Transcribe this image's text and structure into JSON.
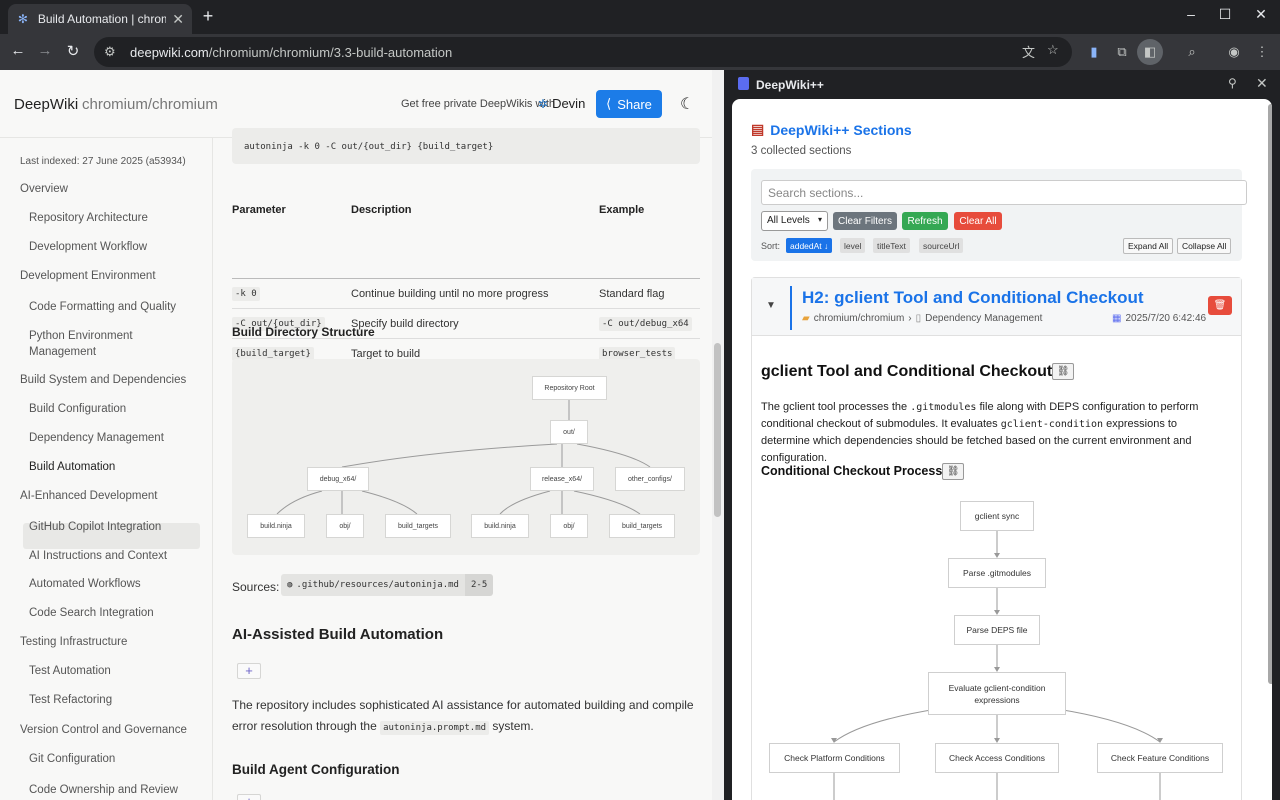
{
  "browser": {
    "tab_title": "Build Automation | chromium/c",
    "tab_close": "✕",
    "new_tab": "+",
    "url_host": "deepwiki.com",
    "url_path": "/chromium/chromium/3.3-build-automation"
  },
  "page": {
    "brand": "DeepWiki",
    "repo": "chromium/chromium",
    "promo": "Get free private DeepWikis with",
    "devin": "Devin",
    "share": "Share",
    "last_indexed": "Last indexed: 27 June 2025 (a53934)",
    "nav": [
      {
        "label": "Overview",
        "level": 1
      },
      {
        "label": "Repository Architecture",
        "level": 2
      },
      {
        "label": "Development Workflow",
        "level": 2
      },
      {
        "label": "Development Environment",
        "level": 1
      },
      {
        "label": "Code Formatting and Quality",
        "level": 2
      },
      {
        "label": "Python Environment Management",
        "level": 2
      },
      {
        "label": "Build System and Dependencies",
        "level": 1
      },
      {
        "label": "Build Configuration",
        "level": 2
      },
      {
        "label": "Dependency Management",
        "level": 2
      },
      {
        "label": "Build Automation",
        "level": 2,
        "active": true
      },
      {
        "label": "AI-Enhanced Development",
        "level": 1
      },
      {
        "label": "GitHub Copilot Integration",
        "level": 2
      },
      {
        "label": "AI Instructions and Context",
        "level": 2
      },
      {
        "label": "Automated Workflows",
        "level": 2
      },
      {
        "label": "Code Search Integration",
        "level": 2
      },
      {
        "label": "Testing Infrastructure",
        "level": 1
      },
      {
        "label": "Test Automation",
        "level": 2
      },
      {
        "label": "Test Refactoring",
        "level": 2
      },
      {
        "label": "Version Control and Governance",
        "level": 1
      },
      {
        "label": "Git Configuration",
        "level": 2
      },
      {
        "label": "Code Ownership and Review",
        "level": 2
      }
    ],
    "code_line": "autoninja -k 0 -C out/{out_dir} {build_target}",
    "table": {
      "headers": [
        "Parameter",
        "Description",
        "Example"
      ],
      "rows": [
        {
          "param": "-k 0",
          "desc": "Continue building until no more progress",
          "example": "Standard flag",
          "example_code": false
        },
        {
          "param": "-C out/{out_dir}",
          "desc": "Specify build directory",
          "example": "-C out/debug_x64",
          "example_code": true
        },
        {
          "param": "{build_target}",
          "desc": "Target to build",
          "example": "browser_tests",
          "example_code": true
        }
      ]
    },
    "dir_title": "Build Directory Structure",
    "dir_nodes": {
      "root": "Repository Root",
      "out": "out/",
      "debug": "debug_x64/",
      "release": "release_x64/",
      "other": "other_configs/",
      "d_ninja": "build.ninja",
      "d_obj": "obj/",
      "d_targets": "build_targets",
      "r_ninja": "build.ninja",
      "r_obj": "obj/",
      "r_targets": "build_targets"
    },
    "sources_label": "Sources:",
    "sources_file": ".github/resources/autoninja.md",
    "sources_lines": "2-5",
    "ai_title": "AI-Assisted Build Automation",
    "ai_para_1": "The repository includes sophisticated AI assistance for automated building and compile error resolution through the ",
    "ai_para_code": "autoninja.prompt.md",
    "ai_para_2": " system.",
    "agent_title": "Build Agent Configuration",
    "plus": "+"
  },
  "sidepanel": {
    "title": "DeepWiki++",
    "heading": "DeepWiki++ Sections",
    "count": "3 collected sections",
    "search_placeholder": "Search sections...",
    "level_select": "All Levels",
    "btn_clear_filters": "Clear Filters",
    "btn_refresh": "Refresh",
    "btn_clear_all": "Clear All",
    "sort_label": "Sort:",
    "sort_options": [
      "addedAt ↓",
      "level",
      "titleText",
      "sourceUrl"
    ],
    "expand_all": "Expand All",
    "collapse_all": "Collapse All",
    "card": {
      "title": "H2: gclient Tool and Conditional Checkout",
      "repo": "chromium/chromium",
      "sep": "›",
      "page": "Dependency Management",
      "date": "2025/7/20 6:42:46",
      "h1": "gclient Tool and Conditional Checkout",
      "para_1": "The gclient tool processes the ",
      "para_code_1": ".gitmodules",
      "para_2": " file along with DEPS configuration to perform conditional checkout of submodules. It evaluates ",
      "para_code_2": "gclient-condition",
      "para_3": " expressions to determine which dependencies should be fetched based on the current environment and configuration.",
      "h2": "Conditional Checkout Process",
      "flow": {
        "n1": "gclient sync",
        "n2": "Parse .gitmodules",
        "n3": "Parse DEPS file",
        "n4": "Evaluate gclient-condition expressions",
        "n5": "Check Platform Conditions",
        "n6": "Check Access Conditions",
        "n7": "Check Feature Conditions"
      }
    }
  },
  "colors": {
    "accent_blue": "#1a73e8",
    "share_blue": "#1c7ce8",
    "refresh_green": "#34a853",
    "clear_red": "#e74c3c",
    "clear_filters_gray": "#6c757d"
  }
}
